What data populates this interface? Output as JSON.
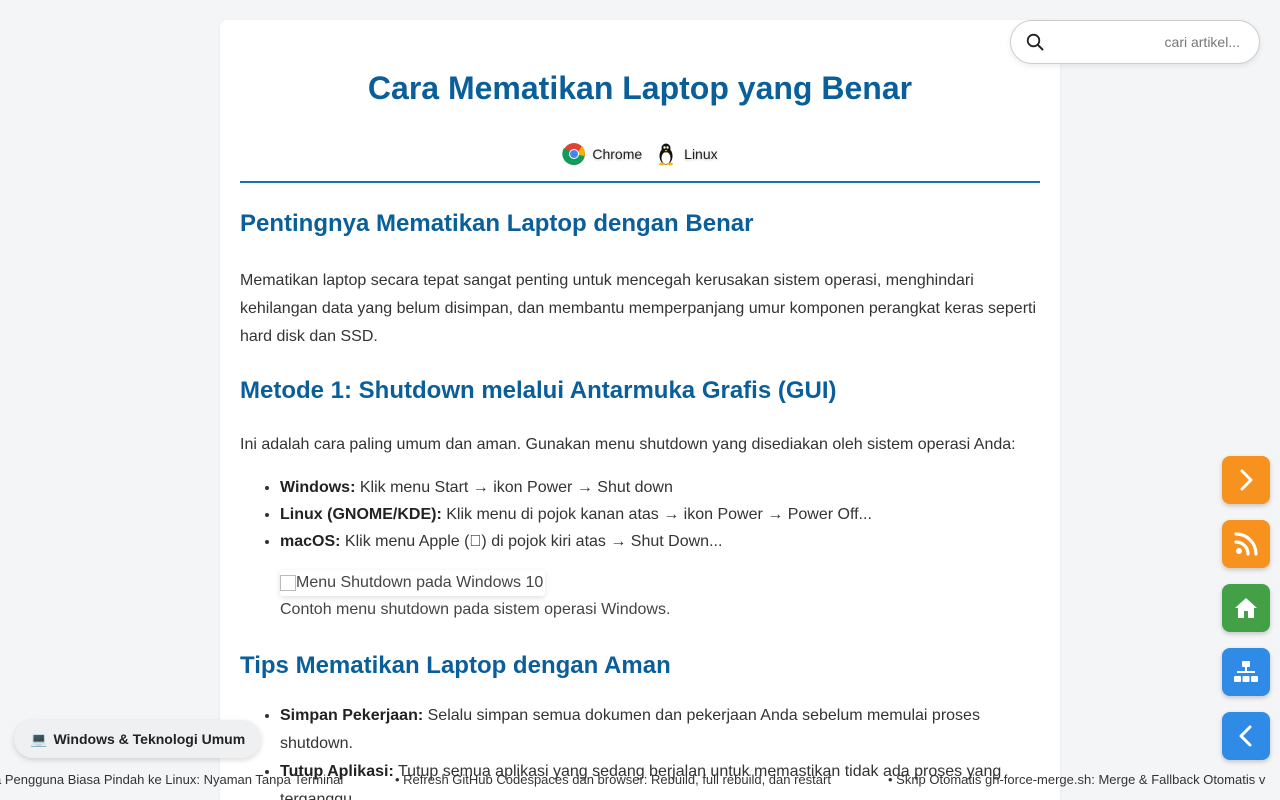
{
  "article": {
    "title": "Cara Mematikan Laptop yang Benar",
    "tags": [
      {
        "label": "Chrome",
        "icon": "chrome-icon"
      },
      {
        "label": "Linux",
        "icon": "linux-tux-icon"
      }
    ],
    "section1": {
      "heading": "Pentingnya Mematikan Laptop dengan Benar",
      "paragraph": "Mematikan laptop secara tepat sangat penting untuk mencegah kerusakan sistem operasi, menghindari kehilangan data yang belum disimpan, dan membantu memperpanjang umur komponen perangkat keras seperti hard disk dan SSD."
    },
    "section2": {
      "heading": "Metode 1: Shutdown melalui Antarmuka Grafis (GUI)",
      "intro": "Ini adalah cara paling umum dan aman. Gunakan menu shutdown yang disediakan oleh sistem operasi Anda:",
      "items": [
        {
          "label": "Windows:",
          "text": " Klik menu Start → ikon Power → Shut down"
        },
        {
          "label": "Linux (GNOME/KDE):",
          "text": " Klik menu di pojok kanan atas → ikon Power → Power Off..."
        },
        {
          "label": "macOS:",
          "text": " Klik menu Apple () di pojok kiri atas → Shut Down..."
        }
      ],
      "image_alt": "Menu Shutdown pada Windows 10",
      "caption": "Contoh menu shutdown pada sistem operasi Windows."
    },
    "section3": {
      "heading": "Tips Mematikan Laptop dengan Aman",
      "items": [
        {
          "label": "Simpan Pekerjaan:",
          "text": " Selalu simpan semua dokumen dan pekerjaan Anda sebelum memulai proses shutdown."
        },
        {
          "label": "Tutup Aplikasi:",
          "text": " Tutup semua aplikasi yang sedang berjalan untuk memastikan tidak ada proses yang terganggu."
        }
      ]
    }
  },
  "search": {
    "placeholder": "cari artikel..."
  },
  "fabs": [
    {
      "name": "next-button",
      "icon": "chevron-right-icon",
      "color": "#f7921e"
    },
    {
      "name": "rss-button",
      "icon": "rss-icon",
      "color": "#f7921e"
    },
    {
      "name": "home-button",
      "icon": "home-icon",
      "color": "#43a047"
    },
    {
      "name": "sitemap-button",
      "icon": "sitemap-icon",
      "color": "#2f8be6"
    },
    {
      "name": "back-button",
      "icon": "chevron-left-icon",
      "color": "#2f8be6"
    }
  ],
  "category": {
    "emoji": "💻",
    "label": "Windows & Teknologi Umum"
  },
  "ticker": [
    "a Pengguna Biasa Pindah ke Linux: Nyaman Tanpa Terminal",
    "• Refresh GitHub Codespaces dan browser: Rebuild, full rebuild, dan restart",
    "• Skrip Otomatis gh-force-merge.sh: Merge & Fallback Otomatis v"
  ]
}
